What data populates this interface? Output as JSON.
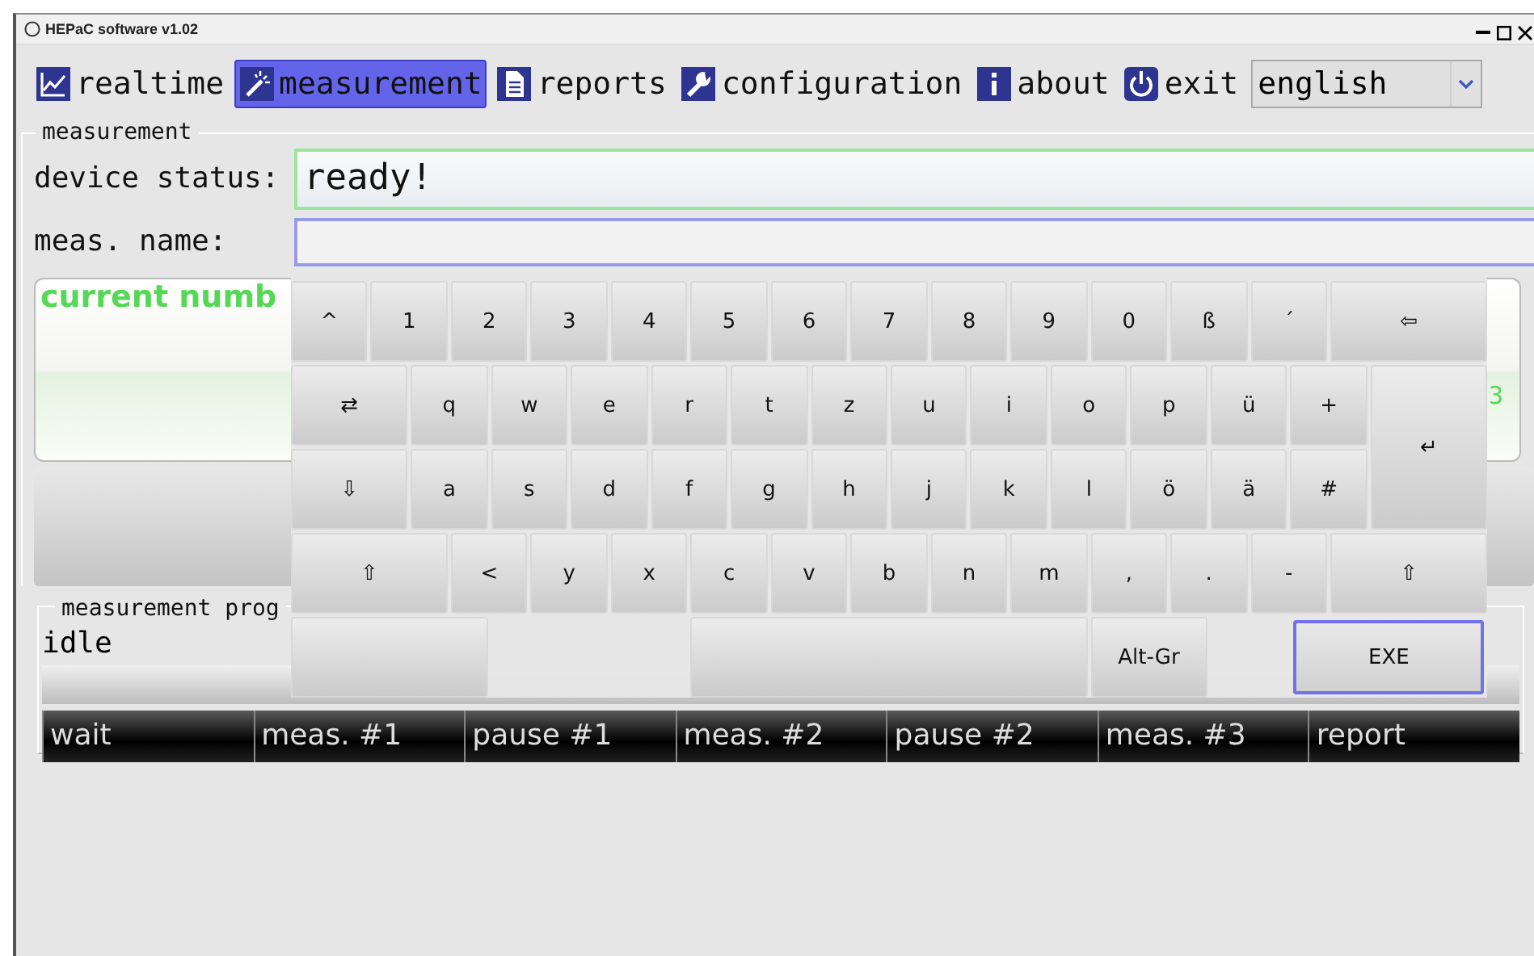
{
  "window": {
    "title": "HEPaC software v1.02"
  },
  "toolbar": [
    {
      "label": "realtime",
      "selected": false
    },
    {
      "label": "measurement",
      "selected": true
    },
    {
      "label": "reports",
      "selected": false
    },
    {
      "label": "configuration",
      "selected": false
    },
    {
      "label": "about",
      "selected": false
    },
    {
      "label": "exit",
      "selected": false
    }
  ],
  "language": {
    "value": "english"
  },
  "measurement": {
    "title": "measurement",
    "device_status": {
      "label": "device status:",
      "value": "ready!"
    },
    "meas_name": {
      "label": "meas. name:"
    },
    "panel": {
      "heading": "current numb",
      "column_2": "3"
    }
  },
  "progress": {
    "title": "measurement prog",
    "state": "idle",
    "level": 0,
    "stages": [
      "wait",
      "meas. #1",
      "pause #1",
      "meas. #2",
      "pause #2",
      "meas. #3",
      "report"
    ]
  },
  "keyboard": {
    "rows": [
      {
        "keys": [
          {
            "kind": "char",
            "label": "^"
          },
          {
            "kind": "char",
            "label": "1"
          },
          {
            "kind": "char",
            "label": "2"
          },
          {
            "kind": "char",
            "label": "3"
          },
          {
            "kind": "char",
            "label": "4"
          },
          {
            "kind": "char",
            "label": "5"
          },
          {
            "kind": "char",
            "label": "6"
          },
          {
            "kind": "char",
            "label": "7"
          },
          {
            "kind": "char",
            "label": "8"
          },
          {
            "kind": "char",
            "label": "9"
          },
          {
            "kind": "char",
            "label": "0"
          },
          {
            "kind": "char",
            "label": "ß"
          },
          {
            "kind": "char",
            "label": "´"
          },
          {
            "kind": "backspace",
            "label": "⇦"
          }
        ]
      },
      {
        "keys": [
          {
            "kind": "tab",
            "label": "⇄"
          },
          {
            "kind": "char",
            "label": "q"
          },
          {
            "kind": "char",
            "label": "w"
          },
          {
            "kind": "char",
            "label": "e"
          },
          {
            "kind": "char",
            "label": "r"
          },
          {
            "kind": "char",
            "label": "t"
          },
          {
            "kind": "char",
            "label": "z"
          },
          {
            "kind": "char",
            "label": "u"
          },
          {
            "kind": "char",
            "label": "i"
          },
          {
            "kind": "char",
            "label": "o"
          },
          {
            "kind": "char",
            "label": "p"
          },
          {
            "kind": "char",
            "label": "ü"
          },
          {
            "kind": "char",
            "label": "+"
          },
          {
            "kind": "enter",
            "label": "↵"
          }
        ]
      },
      {
        "keys": [
          {
            "kind": "caps",
            "label": "⇩"
          },
          {
            "kind": "char",
            "label": "a"
          },
          {
            "kind": "char",
            "label": "s"
          },
          {
            "kind": "char",
            "label": "d"
          },
          {
            "kind": "char",
            "label": "f"
          },
          {
            "kind": "char",
            "label": "g"
          },
          {
            "kind": "char",
            "label": "h"
          },
          {
            "kind": "char",
            "label": "j"
          },
          {
            "kind": "char",
            "label": "k"
          },
          {
            "kind": "char",
            "label": "l"
          },
          {
            "kind": "char",
            "label": "ö"
          },
          {
            "kind": "char",
            "label": "ä"
          },
          {
            "kind": "char",
            "label": "#"
          }
        ]
      },
      {
        "keys": [
          {
            "kind": "shift",
            "label": "⇧"
          },
          {
            "kind": "char",
            "label": "<"
          },
          {
            "kind": "char",
            "label": "y"
          },
          {
            "kind": "char",
            "label": "x"
          },
          {
            "kind": "char",
            "label": "c"
          },
          {
            "kind": "char",
            "label": "v"
          },
          {
            "kind": "char",
            "label": "b"
          },
          {
            "kind": "char",
            "label": "n"
          },
          {
            "kind": "char",
            "label": "m"
          },
          {
            "kind": "char",
            "label": ","
          },
          {
            "kind": "char",
            "label": "."
          },
          {
            "kind": "char",
            "label": "-"
          },
          {
            "kind": "shift",
            "label": "⇧"
          }
        ]
      },
      {
        "keys": [
          {
            "kind": "blank"
          },
          {
            "kind": "gap"
          },
          {
            "kind": "space"
          },
          {
            "kind": "altgr",
            "label": "Alt-Gr"
          },
          {
            "kind": "gap"
          },
          {
            "kind": "exe",
            "label": "EXE"
          }
        ]
      }
    ]
  }
}
